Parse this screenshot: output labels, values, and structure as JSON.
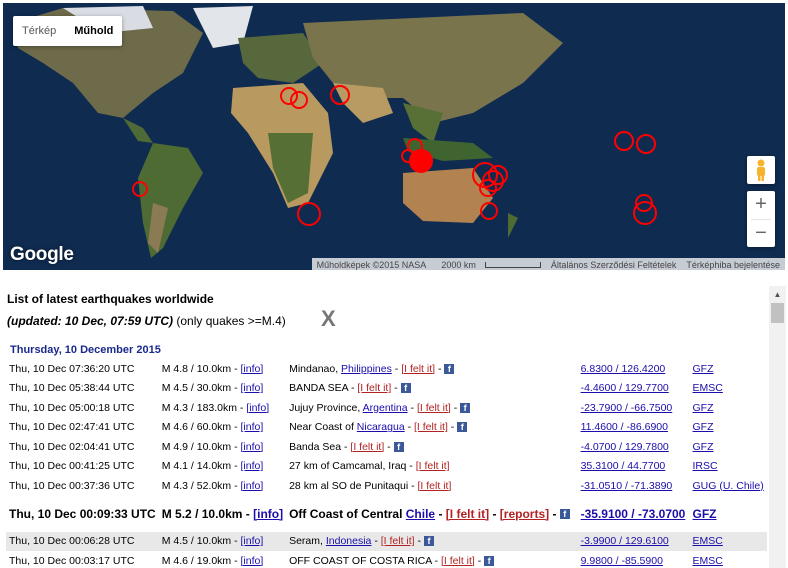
{
  "map": {
    "type_buttons": [
      "Térkép",
      "Műhold"
    ],
    "selected_type": "Műhold",
    "google_logo": "Google",
    "attribution": [
      "Műholdképek ©2015 NASA",
      "2000 km",
      "Általános Szerződési Feltételek",
      "Térképhiba bejelentése"
    ],
    "zoom_in": "+",
    "zoom_out": "−",
    "marker_color": "#ff0000"
  },
  "list": {
    "title": "List of latest earthquakes worldwide",
    "updated_label": "(updated: 10 Dec, 07:59 UTC)",
    "filter_label": "(only quakes >=M.4)",
    "close": "X",
    "day_header": "Thursday, 10 December 2015",
    "rows": [
      {
        "time": "Thu, 10 Dec 07:36:20 UTC",
        "mag": "M 4.8 / 10.0km - ",
        "info": "[info]",
        "loc_pre": "Mindanao, ",
        "loc_link": "Philippines",
        "felt": "[I felt it]",
        "reports": "",
        "coords": "6.8300 / 126.4200",
        "src": "GFZ",
        "alt": false,
        "big": false
      },
      {
        "time": "Thu, 10 Dec 05:38:44 UTC",
        "mag": "M 4.5 / 30.0km - ",
        "info": "[info]",
        "loc_pre": "BANDA SEA",
        "loc_link": "",
        "felt": "[I felt it]",
        "reports": "",
        "coords": "-4.4600 / 129.7700",
        "src": "EMSC",
        "alt": false,
        "big": false
      },
      {
        "time": "Thu, 10 Dec 05:00:18 UTC",
        "mag": "M 4.3 / 183.0km - ",
        "info": "[info]",
        "loc_pre": "Jujuy Province, ",
        "loc_link": "Argentina",
        "felt": "[I felt it]",
        "reports": "",
        "coords": "-23.7900 / -66.7500",
        "src": "GFZ",
        "alt": false,
        "big": false
      },
      {
        "time": "Thu, 10 Dec 02:47:41 UTC",
        "mag": "M 4.6 / 60.0km - ",
        "info": "[info]",
        "loc_pre": "Near Coast of ",
        "loc_link": "Nicaragua",
        "felt": "[I felt it]",
        "reports": "",
        "coords": "11.4600 / -86.6900",
        "src": "GFZ",
        "alt": false,
        "big": false
      },
      {
        "time": "Thu, 10 Dec 02:04:41 UTC",
        "mag": "M 4.9 / 10.0km - ",
        "info": "[info]",
        "loc_pre": "Banda Sea",
        "loc_link": "",
        "felt": "[I felt it]",
        "reports": "",
        "coords": "-4.0700 / 129.7800",
        "src": "GFZ",
        "alt": false,
        "big": false
      },
      {
        "time": "Thu, 10 Dec 00:41:25 UTC",
        "mag": "M 4.1 / 14.0km - ",
        "info": "[info]",
        "loc_pre": "27 km of Camcamal, Iraq",
        "loc_link": "",
        "felt": "[I felt it]",
        "reports": "",
        "coords": "35.3100 / 44.7700",
        "src": "IRSC",
        "alt": false,
        "big": false,
        "nofb": true
      },
      {
        "time": "Thu, 10 Dec 00:37:36 UTC",
        "mag": "M 4.3 / 52.0km - ",
        "info": "[info]",
        "loc_pre": "28 km al SO de Punitaqui",
        "loc_link": "",
        "felt": "[I felt it]",
        "reports": "",
        "coords": "-31.0510 / -71.3890",
        "src": "GUG (U. Chile)",
        "alt": false,
        "big": false,
        "nofb": true
      },
      {
        "time": "Thu, 10 Dec 00:09:33 UTC",
        "mag": "M 5.2 / 10.0km - ",
        "info": "[info]",
        "loc_pre": "Off Coast of Central ",
        "loc_link": "Chile",
        "felt": "[I felt it]",
        "reports": "[reports]",
        "coords": "-35.9100 / -73.0700",
        "src": "GFZ",
        "alt": false,
        "big": true
      },
      {
        "time": "Thu, 10 Dec 00:06:28 UTC",
        "mag": "M 4.5 / 10.0km - ",
        "info": "[info]",
        "loc_pre": "Seram, ",
        "loc_link": "Indonesia",
        "felt": "[I felt it]",
        "reports": "",
        "coords": "-3.9900 / 129.6100",
        "src": "EMSC",
        "alt": true,
        "big": false
      },
      {
        "time": "Thu, 10 Dec 00:03:17 UTC",
        "mag": "M 4.6 / 19.0km - ",
        "info": "[info]",
        "loc_pre": "OFF COAST OF COSTA RICA",
        "loc_link": "",
        "felt": "[I felt it]",
        "reports": "",
        "coords": "9.9800 / -85.5900",
        "src": "EMSC",
        "alt": false,
        "big": false
      }
    ]
  }
}
